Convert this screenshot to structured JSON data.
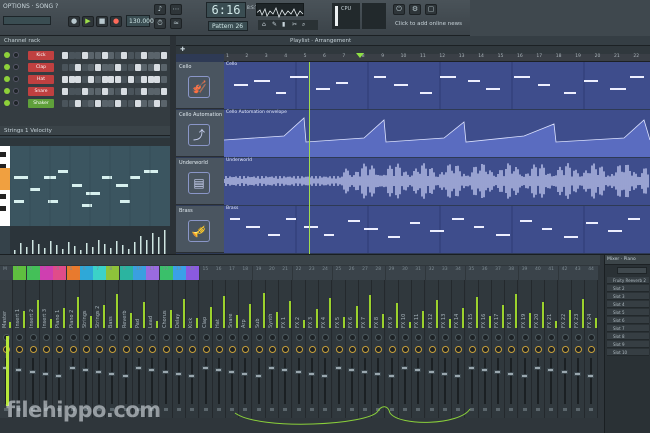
{
  "toolbar": {
    "song_label": "OPTIONS · SONG ?",
    "tempo": "130.000",
    "time_display": "6:16",
    "time_unit": "B:S:T",
    "pattern_name": "Pattern 26",
    "cpu": "CPU",
    "news_text": "Click to add online news"
  },
  "channel_rack": {
    "title": "Channel rack",
    "channels": [
      "Kick",
      "Clap",
      "Hat",
      "Snare",
      "Shaker"
    ]
  },
  "piano_roll": {
    "title": "Strings 1 Velocity"
  },
  "playlist": {
    "title": "Playlist · Arrangement",
    "tracks": [
      {
        "name": "Cello",
        "clip": "Cello"
      },
      {
        "name": "Cello Automation",
        "clip": "Cello Automation envelope"
      },
      {
        "name": "Underworld",
        "clip": "Underworld"
      },
      {
        "name": "Brass",
        "clip": "Brass"
      }
    ],
    "bars": [
      "1",
      "2",
      "3",
      "4",
      "5",
      "6",
      "7",
      "8",
      "9",
      "10",
      "11",
      "12",
      "13",
      "14",
      "15",
      "16",
      "17",
      "18",
      "19",
      "20",
      "21",
      "22"
    ]
  },
  "mixer": {
    "channels": [
      "Master",
      "Insert 1",
      "Insert 2",
      "Insert 3",
      "Piano 1",
      "Piano 2",
      "Strings",
      "Strings 2",
      "Bass",
      "Reverb",
      "Pad",
      "Lead",
      "Chorus",
      "Delay",
      "Kick",
      "Clap",
      "Hat",
      "Snare",
      "Arp",
      "Sub",
      "Synth",
      "FX 1",
      "FX 2",
      "FX 3",
      "FX 4",
      "FX 5",
      "FX 6",
      "FX 7",
      "FX 8",
      "FX 9",
      "FX 10",
      "FX 11",
      "FX 12",
      "FX 13",
      "FX 14",
      "FX 15",
      "FX 16",
      "FX 17",
      "FX 18",
      "FX 19",
      "FX 20",
      "FX 21",
      "FX 22",
      "FX 23",
      "FX 24"
    ],
    "colors": [
      "#3a434a",
      "#5fbf3f",
      "#44c058",
      "#cf3fb0",
      "#e04c8a",
      "#e87a2e",
      "#2ea8d8",
      "#3bd2c8",
      "#8ec23a",
      "#2bb4a0",
      "#3a9fe0",
      "#9a6be0",
      "#3ac06a",
      "#3aa0e8",
      "#8a5ae0",
      "#3a434a",
      "#3a434a",
      "#3a434a",
      "#3a434a",
      "#3a434a",
      "#3a434a",
      "#3a434a",
      "#3a434a",
      "#3a434a",
      "#3a434a",
      "#3a434a",
      "#3a434a",
      "#3a434a",
      "#3a434a",
      "#3a434a",
      "#3a434a",
      "#3a434a",
      "#3a434a",
      "#3a434a",
      "#3a434a",
      "#3a434a",
      "#3a434a",
      "#3a434a",
      "#3a434a",
      "#3a434a",
      "#3a434a",
      "#3a434a",
      "#3a434a",
      "#3a434a",
      "#3a434a"
    ]
  },
  "slot_panel": {
    "title": "Mixer · Piano",
    "slots": [
      "Fruity Reeverb 2",
      "Slot 2",
      "Slot 3",
      "Slot 4",
      "Slot 5",
      "Slot 6",
      "Slot 7",
      "Slot 8",
      "Slot 9",
      "Slot 10"
    ]
  },
  "watermark": "filehippo.com",
  "colors": {
    "playlist_bg": "#3f4f8a",
    "clip": "#4a5fb8",
    "note": "#e8e8ff",
    "waveform": "#cfd6ff",
    "meter": "#9bd22d"
  }
}
